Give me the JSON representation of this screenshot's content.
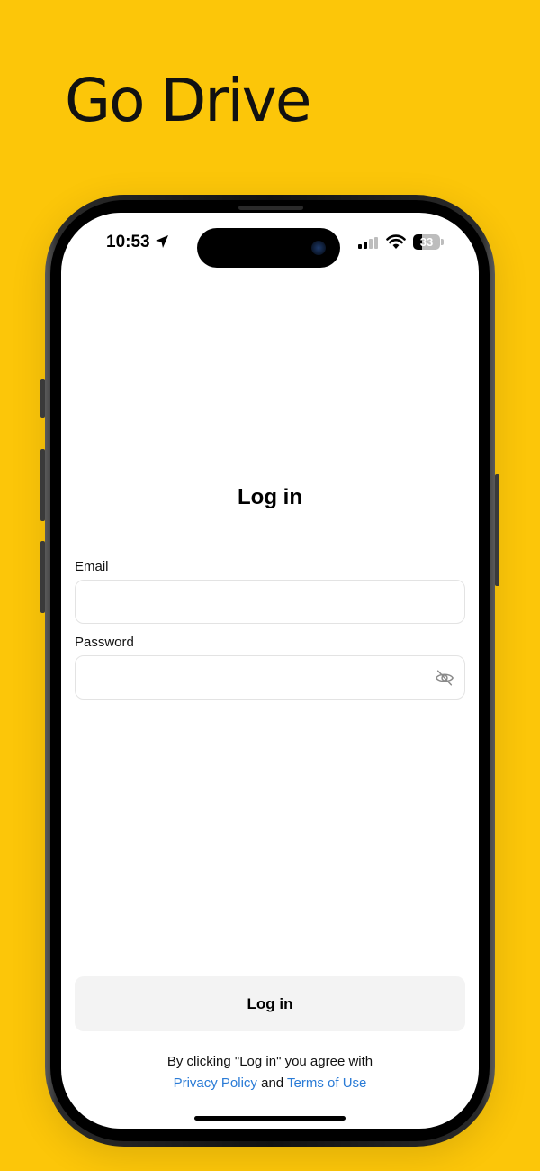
{
  "brand": {
    "title": "Go Drive"
  },
  "status_bar": {
    "time": "10:53",
    "battery_level": 33,
    "battery_text": "33"
  },
  "login": {
    "title": "Log in",
    "email_label": "Email",
    "email_value": "",
    "password_label": "Password",
    "password_value": "",
    "submit_label": "Log in"
  },
  "legal": {
    "prefix": "By clicking \"Log in\" you agree with",
    "privacy_label": "Privacy Policy",
    "and_text": "and",
    "terms_label": "Terms of Use"
  },
  "colors": {
    "background": "#FCC609",
    "link": "#2a7bd6",
    "button_bg": "#f3f3f3"
  }
}
